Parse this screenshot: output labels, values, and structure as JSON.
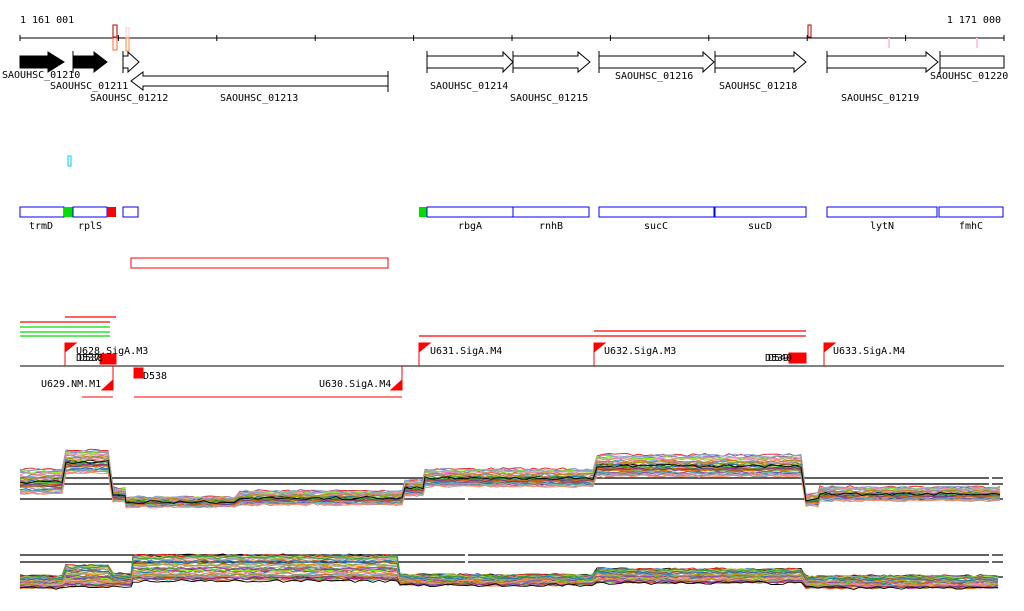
{
  "axis": {
    "start_label": "1 161 001",
    "end_label": "1 171 000"
  },
  "locus_tags": [
    "SAOUHSC_01210",
    "SAOUHSC_01211",
    "SAOUHSC_01212",
    "SAOUHSC_01213",
    "SAOUHSC_01214",
    "SAOUHSC_01215",
    "SAOUHSC_01216",
    "SAOUHSC_01218",
    "SAOUHSC_01219",
    "SAOUHSC_01220"
  ],
  "gene_names": [
    "trmD",
    "rplS",
    "rbgA",
    "rnhB",
    "sucC",
    "sucD",
    "lytN",
    "fmhC"
  ],
  "promoters": [
    "U628.SigA.M3",
    "U629.NM.M1",
    "U630.SigA.M4",
    "U631.SigA.M4",
    "U632.SigA.M3",
    "U633.SigA.M4"
  ],
  "terminators": [
    "D537",
    "D538",
    "D538",
    "D539",
    "D540"
  ],
  "colors": {
    "gene_outline": "#0000ff",
    "start": "#00dd00",
    "stop": "#ff0000",
    "feature": "#ff0000",
    "axis": "#000000"
  }
}
